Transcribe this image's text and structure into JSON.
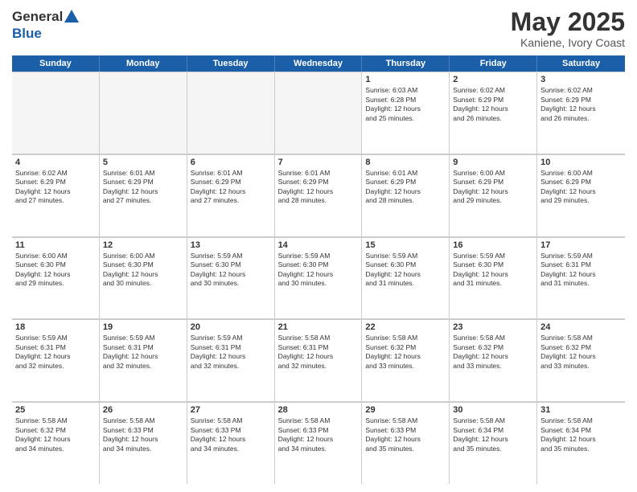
{
  "logo": {
    "line1": "General",
    "line2": "Blue"
  },
  "title": {
    "month_year": "May 2025",
    "location": "Kaniene, Ivory Coast"
  },
  "header_days": [
    "Sunday",
    "Monday",
    "Tuesday",
    "Wednesday",
    "Thursday",
    "Friday",
    "Saturday"
  ],
  "rows": [
    [
      {
        "day": "",
        "text": "",
        "empty": true
      },
      {
        "day": "",
        "text": "",
        "empty": true
      },
      {
        "day": "",
        "text": "",
        "empty": true
      },
      {
        "day": "",
        "text": "",
        "empty": true
      },
      {
        "day": "1",
        "text": "Sunrise: 6:03 AM\nSunset: 6:28 PM\nDaylight: 12 hours\nand 25 minutes."
      },
      {
        "day": "2",
        "text": "Sunrise: 6:02 AM\nSunset: 6:29 PM\nDaylight: 12 hours\nand 26 minutes."
      },
      {
        "day": "3",
        "text": "Sunrise: 6:02 AM\nSunset: 6:29 PM\nDaylight: 12 hours\nand 26 minutes."
      }
    ],
    [
      {
        "day": "4",
        "text": "Sunrise: 6:02 AM\nSunset: 6:29 PM\nDaylight: 12 hours\nand 27 minutes."
      },
      {
        "day": "5",
        "text": "Sunrise: 6:01 AM\nSunset: 6:29 PM\nDaylight: 12 hours\nand 27 minutes."
      },
      {
        "day": "6",
        "text": "Sunrise: 6:01 AM\nSunset: 6:29 PM\nDaylight: 12 hours\nand 27 minutes."
      },
      {
        "day": "7",
        "text": "Sunrise: 6:01 AM\nSunset: 6:29 PM\nDaylight: 12 hours\nand 28 minutes."
      },
      {
        "day": "8",
        "text": "Sunrise: 6:01 AM\nSunset: 6:29 PM\nDaylight: 12 hours\nand 28 minutes."
      },
      {
        "day": "9",
        "text": "Sunrise: 6:00 AM\nSunset: 6:29 PM\nDaylight: 12 hours\nand 29 minutes."
      },
      {
        "day": "10",
        "text": "Sunrise: 6:00 AM\nSunset: 6:29 PM\nDaylight: 12 hours\nand 29 minutes."
      }
    ],
    [
      {
        "day": "11",
        "text": "Sunrise: 6:00 AM\nSunset: 6:30 PM\nDaylight: 12 hours\nand 29 minutes."
      },
      {
        "day": "12",
        "text": "Sunrise: 6:00 AM\nSunset: 6:30 PM\nDaylight: 12 hours\nand 30 minutes."
      },
      {
        "day": "13",
        "text": "Sunrise: 5:59 AM\nSunset: 6:30 PM\nDaylight: 12 hours\nand 30 minutes."
      },
      {
        "day": "14",
        "text": "Sunrise: 5:59 AM\nSunset: 6:30 PM\nDaylight: 12 hours\nand 30 minutes."
      },
      {
        "day": "15",
        "text": "Sunrise: 5:59 AM\nSunset: 6:30 PM\nDaylight: 12 hours\nand 31 minutes."
      },
      {
        "day": "16",
        "text": "Sunrise: 5:59 AM\nSunset: 6:30 PM\nDaylight: 12 hours\nand 31 minutes."
      },
      {
        "day": "17",
        "text": "Sunrise: 5:59 AM\nSunset: 6:31 PM\nDaylight: 12 hours\nand 31 minutes."
      }
    ],
    [
      {
        "day": "18",
        "text": "Sunrise: 5:59 AM\nSunset: 6:31 PM\nDaylight: 12 hours\nand 32 minutes."
      },
      {
        "day": "19",
        "text": "Sunrise: 5:59 AM\nSunset: 6:31 PM\nDaylight: 12 hours\nand 32 minutes."
      },
      {
        "day": "20",
        "text": "Sunrise: 5:59 AM\nSunset: 6:31 PM\nDaylight: 12 hours\nand 32 minutes."
      },
      {
        "day": "21",
        "text": "Sunrise: 5:58 AM\nSunset: 6:31 PM\nDaylight: 12 hours\nand 32 minutes."
      },
      {
        "day": "22",
        "text": "Sunrise: 5:58 AM\nSunset: 6:32 PM\nDaylight: 12 hours\nand 33 minutes."
      },
      {
        "day": "23",
        "text": "Sunrise: 5:58 AM\nSunset: 6:32 PM\nDaylight: 12 hours\nand 33 minutes."
      },
      {
        "day": "24",
        "text": "Sunrise: 5:58 AM\nSunset: 6:32 PM\nDaylight: 12 hours\nand 33 minutes."
      }
    ],
    [
      {
        "day": "25",
        "text": "Sunrise: 5:58 AM\nSunset: 6:32 PM\nDaylight: 12 hours\nand 34 minutes."
      },
      {
        "day": "26",
        "text": "Sunrise: 5:58 AM\nSunset: 6:33 PM\nDaylight: 12 hours\nand 34 minutes."
      },
      {
        "day": "27",
        "text": "Sunrise: 5:58 AM\nSunset: 6:33 PM\nDaylight: 12 hours\nand 34 minutes."
      },
      {
        "day": "28",
        "text": "Sunrise: 5:58 AM\nSunset: 6:33 PM\nDaylight: 12 hours\nand 34 minutes."
      },
      {
        "day": "29",
        "text": "Sunrise: 5:58 AM\nSunset: 6:33 PM\nDaylight: 12 hours\nand 35 minutes."
      },
      {
        "day": "30",
        "text": "Sunrise: 5:58 AM\nSunset: 6:34 PM\nDaylight: 12 hours\nand 35 minutes."
      },
      {
        "day": "31",
        "text": "Sunrise: 5:58 AM\nSunset: 6:34 PM\nDaylight: 12 hours\nand 35 minutes."
      }
    ]
  ]
}
